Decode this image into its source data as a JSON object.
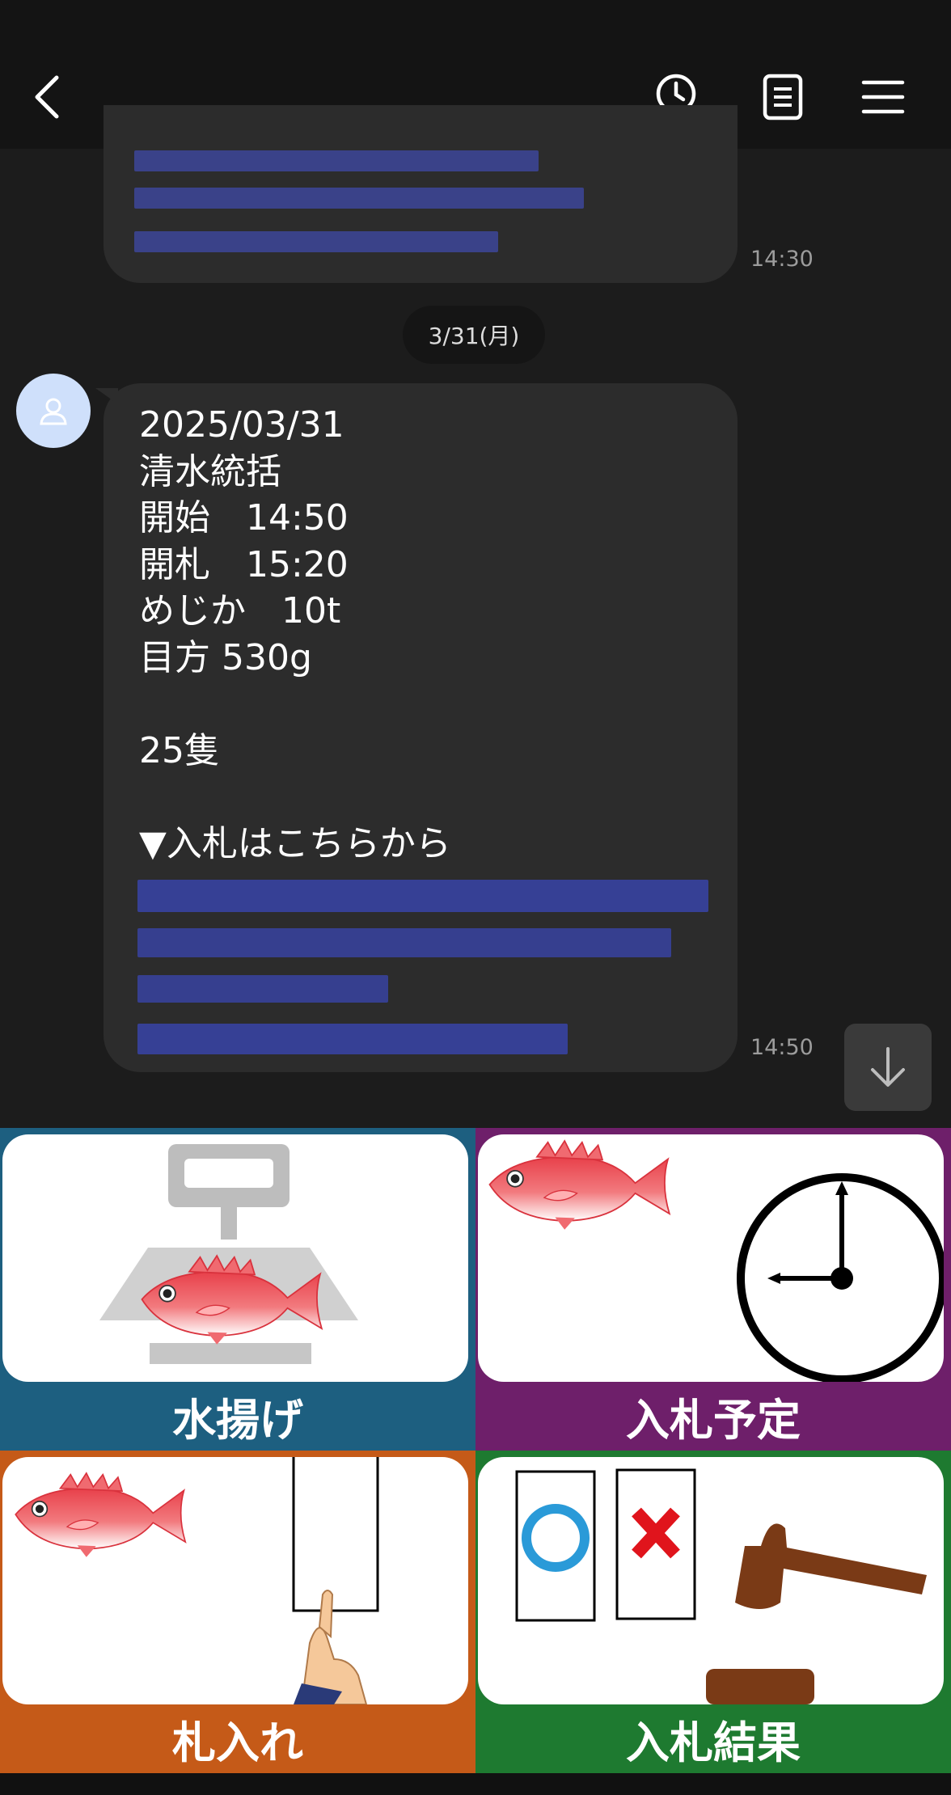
{
  "header": {
    "back_icon": "chevron-left-icon",
    "actions": [
      "clock-search-icon",
      "notes-icon",
      "hamburger-menu-icon"
    ]
  },
  "chat": {
    "prev_message": {
      "time": "14:30",
      "link_blurred": true
    },
    "date_separator": "3/31(月)",
    "message": {
      "text": "2025/03/31\n清水統括\n開始　14:50\n開札　15:20\nめじか　10t\n目方 530g\n\n25隻\n\n▼入札はこちらから",
      "link_blurred": true,
      "time": "14:50"
    },
    "scroll_down_icon": "arrow-down-icon"
  },
  "rich_menu": {
    "tiles": [
      {
        "label": "水揚げ",
        "color": "#1d5f80"
      },
      {
        "label": "入札予定",
        "color": "#6e1f6a"
      },
      {
        "label": "札入れ",
        "color": "#c55a18"
      },
      {
        "label": "入札結果",
        "color": "#1e7a30"
      }
    ]
  },
  "colors": {
    "background": "#1c1c1c",
    "header": "#141414",
    "bubble": "#2c2c2c",
    "link": "#4a5be0"
  }
}
